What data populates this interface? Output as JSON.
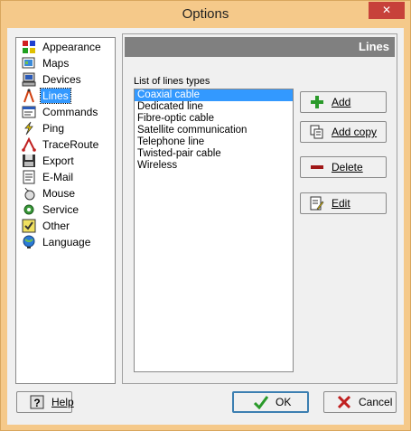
{
  "window": {
    "title": "Options",
    "close_label": "✕"
  },
  "nav": {
    "items": [
      {
        "label": "Appearance",
        "icon": "appearance-icon"
      },
      {
        "label": "Maps",
        "icon": "maps-icon"
      },
      {
        "label": "Devices",
        "icon": "devices-icon"
      },
      {
        "label": "Lines",
        "icon": "lines-icon",
        "selected": true
      },
      {
        "label": "Commands",
        "icon": "commands-icon"
      },
      {
        "label": "Ping",
        "icon": "ping-icon"
      },
      {
        "label": "TraceRoute",
        "icon": "traceroute-icon"
      },
      {
        "label": "Export",
        "icon": "export-icon"
      },
      {
        "label": "E-Mail",
        "icon": "email-icon"
      },
      {
        "label": "Mouse",
        "icon": "mouse-icon"
      },
      {
        "label": "Service",
        "icon": "service-icon"
      },
      {
        "label": "Other",
        "icon": "other-icon"
      },
      {
        "label": "Language",
        "icon": "language-icon"
      }
    ]
  },
  "panel": {
    "header": "Lines",
    "list_label": "List of lines types",
    "items": [
      "Coaxial cable",
      "Dedicated line",
      "Fibre-optic cable",
      "Satellite communication",
      "Telephone line",
      "Twisted-pair cable",
      "Wireless"
    ],
    "selected_index": 0,
    "buttons": {
      "add": "Add",
      "add_copy": "Add copy",
      "delete": "Delete",
      "edit": "Edit"
    }
  },
  "footer": {
    "help": "Help",
    "ok": "OK",
    "cancel": "Cancel"
  }
}
